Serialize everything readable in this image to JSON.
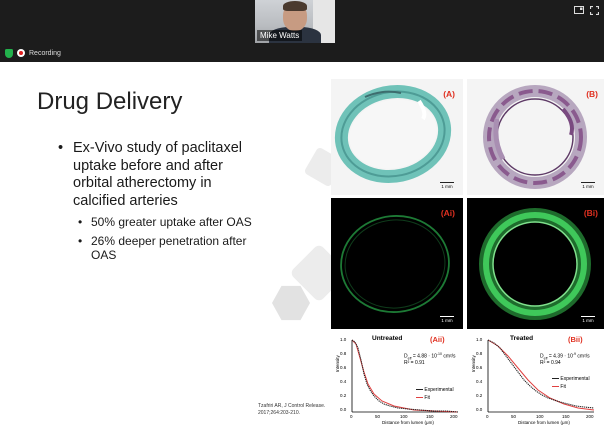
{
  "meeting": {
    "participant_name": "Mike Watts",
    "recording_label": "Recording"
  },
  "slide": {
    "title": "Drug Delivery",
    "bullet": "Ex-Vivo study of paclitaxel uptake before and after orbital atherectomy in calcified arteries",
    "sub_bullets": [
      "50% greater uptake after OAS",
      "26% deeper penetration after OAS"
    ],
    "citation_line1": "Tzafriri AR, J Control Release.",
    "citation_line2": "2017;264:203-210."
  },
  "figure": {
    "panels": {
      "a": "(A)",
      "b": "(B)",
      "ai": "(Ai)",
      "bi": "(Bi)",
      "aii": "(Aii)",
      "bii": "(Bii)"
    },
    "scale_label": "1 mm",
    "graph_untreated": {
      "title": "Untreated",
      "d_eff": "D",
      "d_eff_sub": "eff",
      "d_eff_val": " = 4.88 · 10",
      "d_eff_exp": "-10",
      "d_eff_unit": " cm²/s",
      "r2": "R² = 0.91"
    },
    "graph_treated": {
      "title": "Treated",
      "d_eff": "D",
      "d_eff_sub": "eff",
      "d_eff_val": " = 4.39 · 10",
      "d_eff_exp": "-9",
      "d_eff_unit": " cm²/s",
      "r2": "R² = 0.94"
    },
    "legend_experimental": "Experimental",
    "legend_fit": "Fit",
    "ylabel": "Intensity",
    "xlabel": "Distance from lumen (μm)",
    "yticks": [
      "1.0",
      "0.8",
      "0.6",
      "0.4",
      "0.2",
      "0.0"
    ],
    "xticks": [
      "0",
      "50",
      "100",
      "150",
      "200"
    ]
  },
  "colors": {
    "stain_teal": "#6fc2b8",
    "stain_purple": "#8a5a8e",
    "fluorescence_green": "#3fc85a",
    "label_red": "#e03020",
    "fit_red": "#e04040"
  }
}
